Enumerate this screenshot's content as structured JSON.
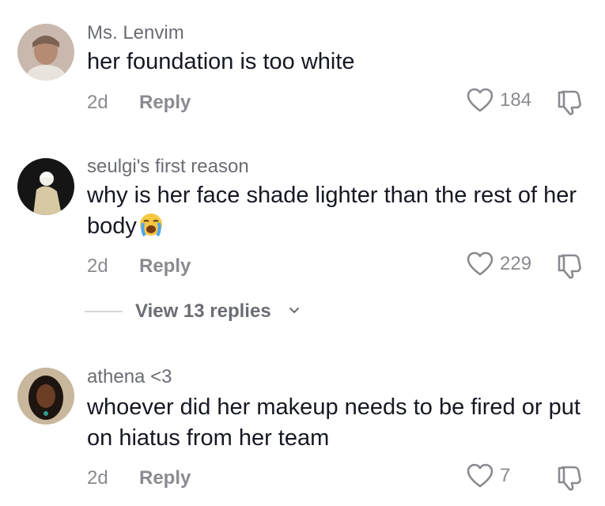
{
  "comments": [
    {
      "username": "Ms. Lenvim",
      "text": "her foundation is too white",
      "time": "2d",
      "reply_label": "Reply",
      "likes": "184"
    },
    {
      "username": "seulgi's first reason",
      "text": "why is her face shade lighter than the rest of her body",
      "time": "2d",
      "reply_label": "Reply",
      "likes": "229",
      "emoji_icon": "loudly-crying-face-icon"
    },
    {
      "username": "athena <3",
      "text": "whoever did her makeup needs to be fired or put on hiatus from her team",
      "time": "2d",
      "reply_label": "Reply",
      "likes": "7"
    }
  ],
  "view_replies": {
    "label": "View 13 replies"
  },
  "colors": {
    "text": "#161823",
    "meta": "#8a8b91",
    "username": "#6b6d74"
  }
}
